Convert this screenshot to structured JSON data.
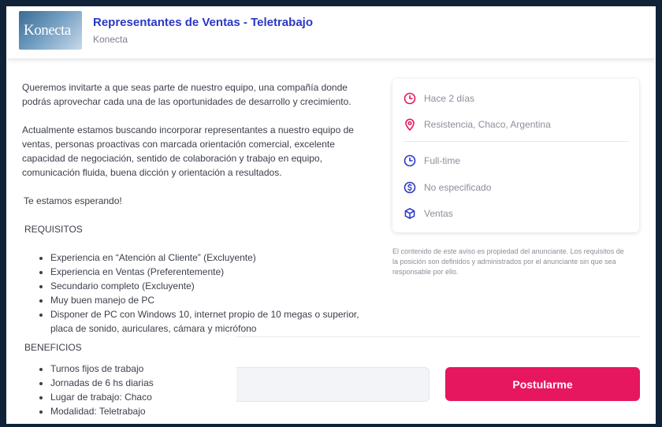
{
  "header": {
    "logo_text": "Konecta",
    "title": "Representantes de Ventas - Teletrabajo",
    "company": "Konecta"
  },
  "description": {
    "intro": "Queremos invitarte a que seas parte de nuestro equipo, una compañía donde podrás aprovechar cada una de las oportunidades de desarrollo y crecimiento.",
    "search": "Actualmente estamos buscando incorporar representantes a nuestro equipo de ventas, personas proactivas con marcada orientación comercial, excelente capacidad de negociación, sentido de colaboración y trabajo en equipo, comunicación fluida, buena dicción y orientación a resultados.",
    "waiting": "Te estamos esperando!",
    "requirements_heading": "REQUISITOS",
    "requirements": [
      "Experiencia en “Atención al Cliente” (Excluyente)",
      "Experiencia en Ventas (Preferentemente)",
      "Secundario completo (Excluyente)",
      "Muy buen manejo de PC",
      "Disponer de PC con Windows 10, internet propio de 10 megas o superior, placa de sonido, auriculares, cámara y micrófono"
    ],
    "benefits_heading": "BENEFICIOS",
    "benefits": [
      "Turnos fijos de trabajo",
      "Jornadas de 6 hs diarias",
      "Lugar de trabajo: Chaco",
      "Modalidad: Teletrabajo"
    ]
  },
  "details": {
    "posted": "Hace 2 días",
    "location": "Resistencia, Chaco, Argentina",
    "schedule": "Full-time",
    "salary": "No especificado",
    "area": "Ventas"
  },
  "disclaimer": "El contenido de este aviso es propiedad del anunciante. Los requisitos de la posición son definidos y administrados por el anunciante sin que sea responsable por ello.",
  "actions": {
    "apply_label": "Postularme"
  },
  "colors": {
    "title_blue": "#2a37c4",
    "apply_pink": "#e6165f",
    "icon_pink": "#e6165f",
    "icon_blue": "#2a37c4"
  }
}
